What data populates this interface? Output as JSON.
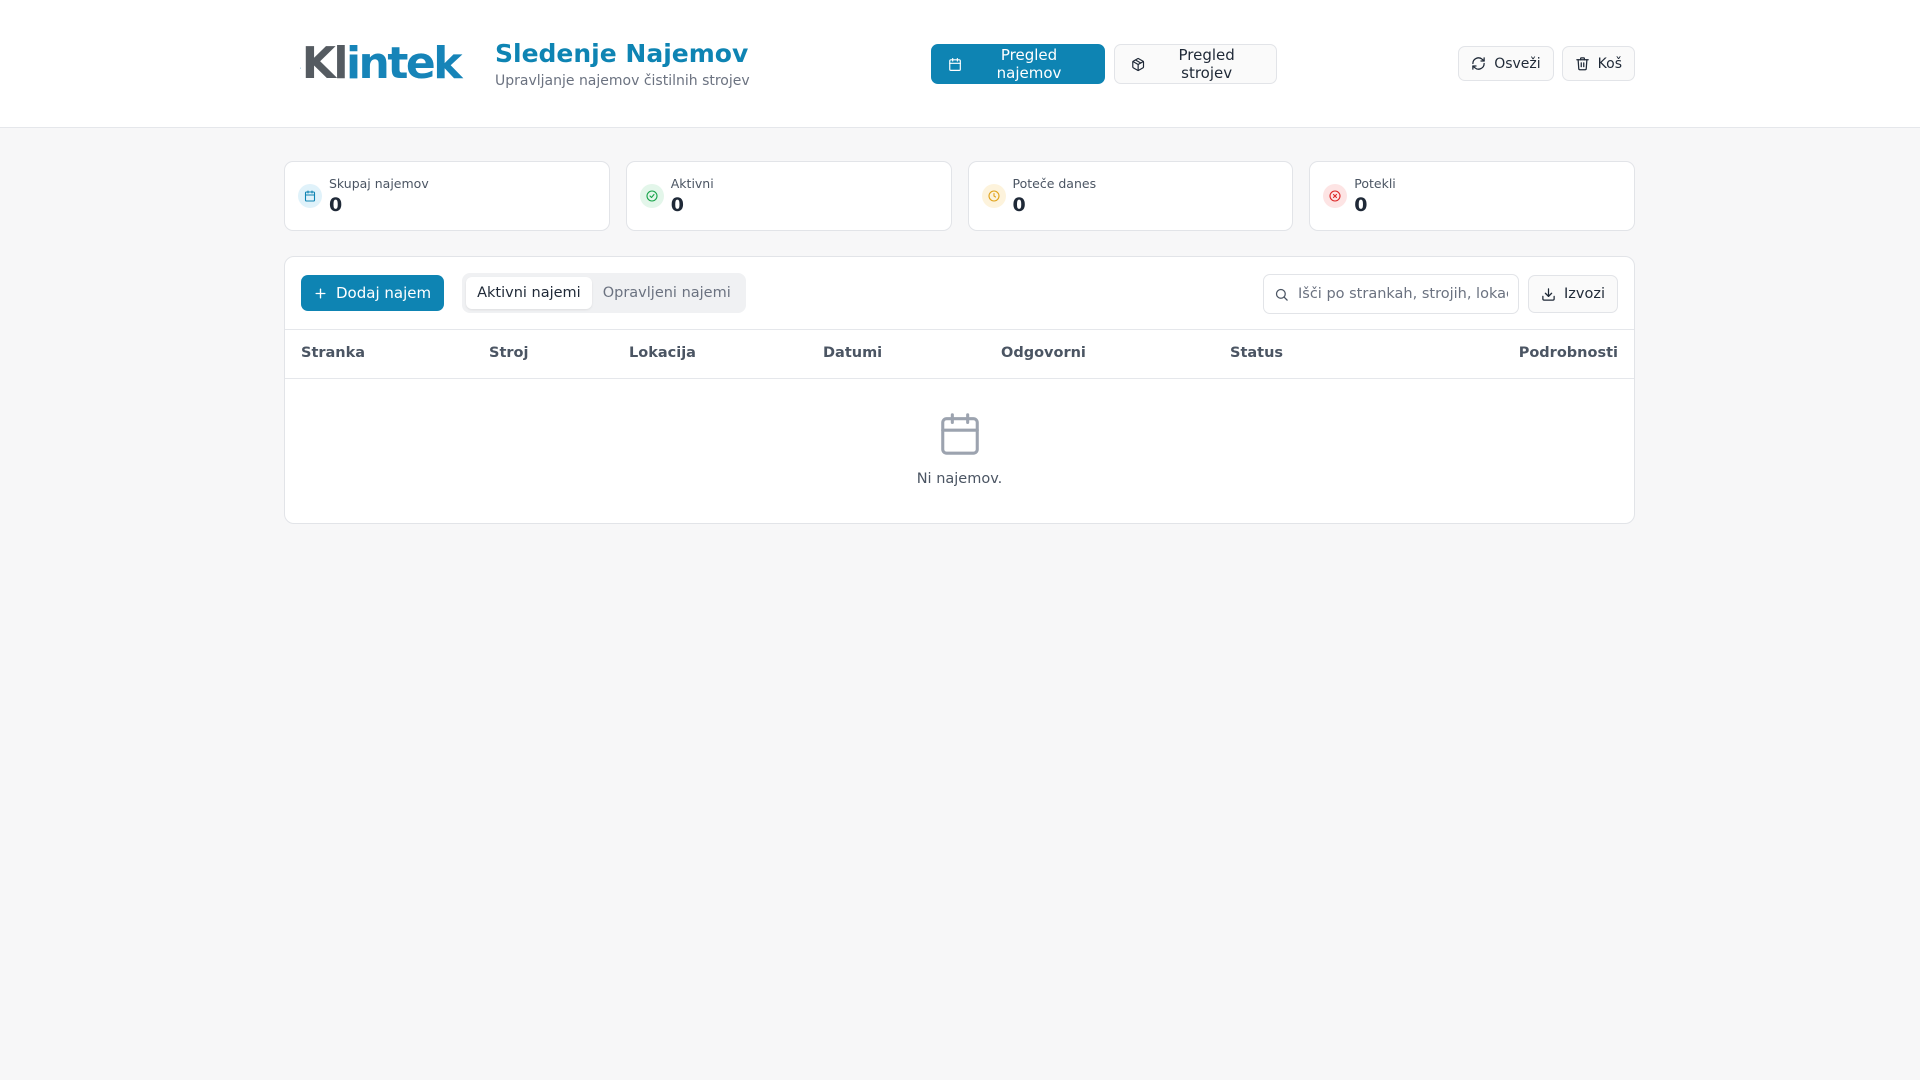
{
  "brand": {
    "logo_main": "Kl",
    "logo_accent": "intek"
  },
  "header": {
    "title": "Sledenje Najemov",
    "subtitle": "Upravljanje najemov čistilnih strojev"
  },
  "nav": {
    "rentals_overview": "Pregled najemov",
    "machines_overview": "Pregled strojev"
  },
  "actions": {
    "refresh": "Osveži",
    "trash": "Koš"
  },
  "stats": [
    {
      "label": "Skupaj najemov",
      "value": "0",
      "icon": "calendar-icon",
      "color": "#0e84b3",
      "bg": "#e0f2fa"
    },
    {
      "label": "Aktivni",
      "value": "0",
      "icon": "check-circle-icon",
      "color": "#16a34a",
      "bg": "#e3f6ea"
    },
    {
      "label": "Poteče danes",
      "value": "0",
      "icon": "clock-icon",
      "color": "#e0a21a",
      "bg": "#fdf3dc"
    },
    {
      "label": "Potekli",
      "value": "0",
      "icon": "x-circle-icon",
      "color": "#dc2626",
      "bg": "#fde4e4"
    }
  ],
  "toolbar": {
    "add_label": "Dodaj najem",
    "tabs": [
      {
        "label": "Aktivni najemi",
        "active": true
      },
      {
        "label": "Opravljeni najemi",
        "active": false
      }
    ],
    "search_placeholder": "Išči po strankah, strojih, lokac",
    "export_label": "Izvozi"
  },
  "table": {
    "columns": [
      "Stranka",
      "Stroj",
      "Lokacija",
      "Datumi",
      "Odgovorni",
      "Status",
      "Podrobnosti"
    ]
  },
  "empty": {
    "message": "Ni najemov."
  }
}
